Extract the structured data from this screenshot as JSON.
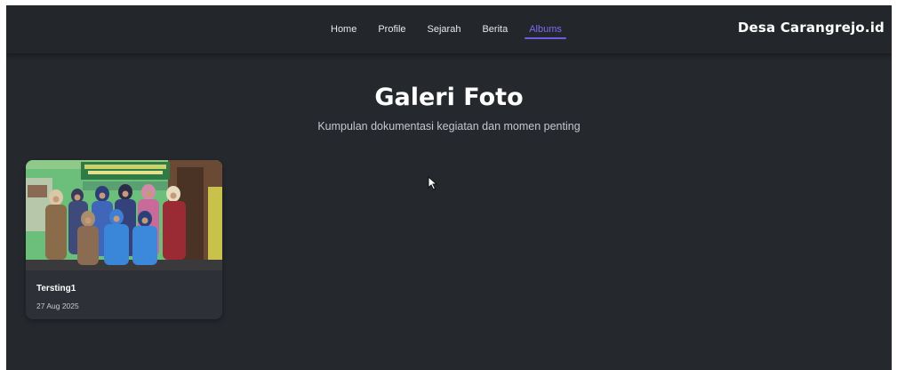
{
  "nav": {
    "items": [
      {
        "label": "Home"
      },
      {
        "label": "Profile"
      },
      {
        "label": "Sejarah"
      },
      {
        "label": "Berita"
      },
      {
        "label": "Albums"
      }
    ],
    "active_item": "Albums",
    "brand": "Desa Carangrejo.id"
  },
  "hero": {
    "title": "Galeri Foto",
    "subtitle": "Kumpulan dokumentasi kegiatan dan momen penting"
  },
  "albums": [
    {
      "title": "Tersting1",
      "date": "27 Aug 2025"
    }
  ],
  "colors": {
    "background": "#25282d",
    "navbar": "#23262b",
    "accent": "#6c5ce7",
    "card": "#2d3137"
  },
  "icons": [
    "mouse-pointer-icon"
  ]
}
